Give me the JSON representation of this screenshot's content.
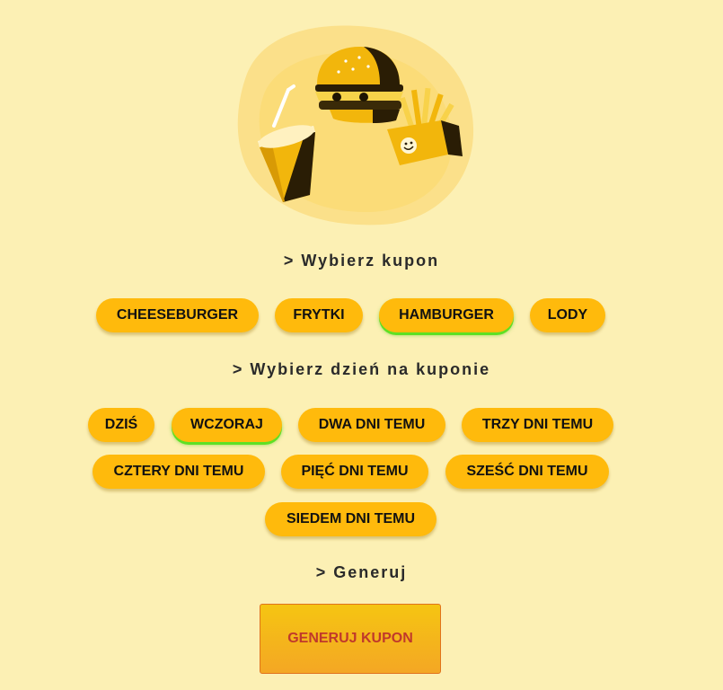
{
  "sections": {
    "coupon_title": "> Wybierz kupon",
    "day_title": "> Wybierz dzień na kuponie",
    "generate_title": "> Generuj"
  },
  "coupons": [
    {
      "label": "CHEESEBURGER",
      "selected": false
    },
    {
      "label": "FRYTKI",
      "selected": false
    },
    {
      "label": "HAMBURGER",
      "selected": true
    },
    {
      "label": "LODY",
      "selected": false
    }
  ],
  "days": [
    {
      "label": "DZIŚ",
      "selected": false
    },
    {
      "label": "WCZORAJ",
      "selected": true
    },
    {
      "label": "DWA DNI TEMU",
      "selected": false
    },
    {
      "label": "TRZY DNI TEMU",
      "selected": false
    },
    {
      "label": "CZTERY DNI TEMU",
      "selected": false
    },
    {
      "label": "PIĘĆ DNI TEMU",
      "selected": false
    },
    {
      "label": "SZEŚĆ DNI TEMU",
      "selected": false
    },
    {
      "label": "SIEDEM DNI TEMU",
      "selected": false
    }
  ],
  "generate_button": "GENERUJ KUPON",
  "colors": {
    "background": "#fcf0b4",
    "pill": "#ffba0c",
    "selected_glow": "#5ee024",
    "generate_text": "#c0392b"
  },
  "illustration": {
    "icons": [
      "drink-cup-icon",
      "burger-icon",
      "fries-icon"
    ]
  }
}
